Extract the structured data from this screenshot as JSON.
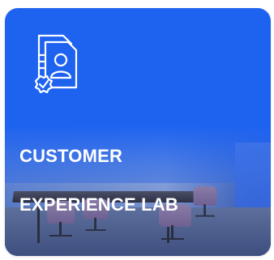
{
  "card": {
    "title_line1": "CUSTOMER",
    "title_line2": "EXPERIENCE LAB",
    "icon": "profile-document-certified-icon",
    "accent_color": "#1e63f0"
  }
}
